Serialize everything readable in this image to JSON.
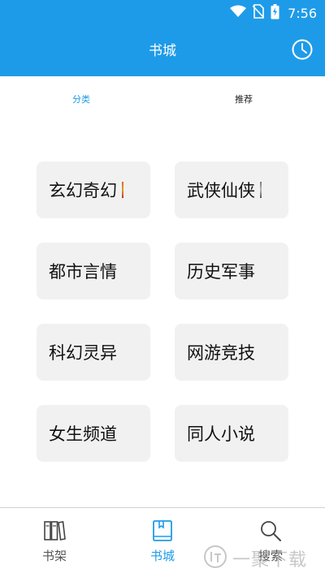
{
  "status_bar": {
    "time": "7:56"
  },
  "app_bar": {
    "title": "书城"
  },
  "tabs": [
    {
      "label": "分类",
      "active": true
    },
    {
      "label": "推荐",
      "active": false
    }
  ],
  "categories": [
    {
      "label": "玄幻奇幻"
    },
    {
      "label": "武侠仙侠"
    },
    {
      "label": "都市言情"
    },
    {
      "label": "历史军事"
    },
    {
      "label": "科幻灵异"
    },
    {
      "label": "网游竞技"
    },
    {
      "label": "女生频道"
    },
    {
      "label": "同人小说"
    }
  ],
  "bottom_nav": [
    {
      "label": "书架",
      "icon": "bookshelf-icon",
      "active": false
    },
    {
      "label": "书城",
      "icon": "bookstore-icon",
      "active": true
    },
    {
      "label": "搜索",
      "icon": "search-icon",
      "active": false
    }
  ],
  "watermark": {
    "text": "一聚下载"
  },
  "colors": {
    "accent": "#1e9be8",
    "tile_bg": "#f1f1f1"
  }
}
